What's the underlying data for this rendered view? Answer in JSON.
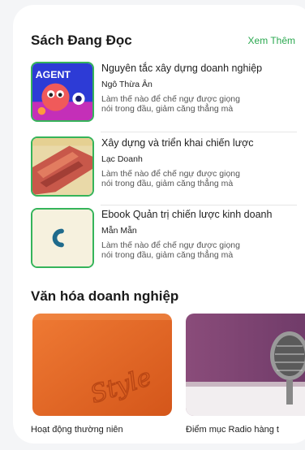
{
  "reading": {
    "title": "Sách Đang Đọc",
    "see_more": "Xem Thêm",
    "books": [
      {
        "title": "Nguyên tắc xây dựng doanh nghiệp",
        "author": "Ngô Thừa Ân",
        "desc_line1": "Làm thế nào để chế ngự được giọng",
        "desc_line2": "nói trong đầu, giảm căng thẳng mà",
        "cover_text": "AGENT"
      },
      {
        "title": "Xây dựng và triển khai chiến lược",
        "author": "Lạc Doanh",
        "desc_line1": "Làm thế nào để chế ngự được giọng",
        "desc_line2": "nói trong đầu, giảm căng thẳng mà"
      },
      {
        "title": "Ebook Quản trị chiến lược kinh doanh",
        "author": "Mẫn Mẫn",
        "desc_line1": "Làm thế nào để chế ngự được giọng",
        "desc_line2": "nói trong đầu, giảm căng thẳng mà"
      }
    ]
  },
  "culture": {
    "title": "Văn hóa doanh nghiệp",
    "items": [
      {
        "label": "Hoạt động thường niên",
        "image_text": "Style"
      },
      {
        "label": "Điểm mục Radio hàng t"
      }
    ]
  },
  "colors": {
    "accent": "#2aa84f",
    "cover_border": "#35b45a",
    "orange": "#e2601c"
  }
}
